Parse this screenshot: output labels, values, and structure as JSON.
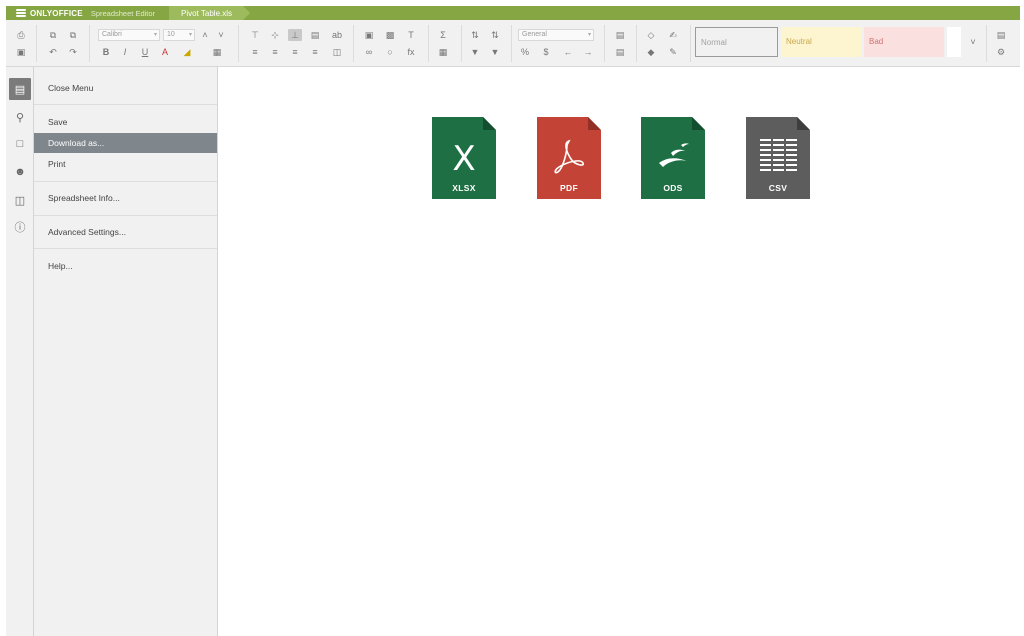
{
  "titlebar": {
    "brand": "ONLYOFFICE",
    "product": "Spreadsheet Editor",
    "document": "Pivot Table.xls",
    "color": "#86a643"
  },
  "toolbar": {
    "font_name": "Calibri",
    "font_size": "10",
    "number_format": "General",
    "styles": [
      {
        "label": "Normal",
        "color": "#a0a0a0",
        "bg": "#ffffff"
      },
      {
        "label": "Neutral",
        "color": "#c9a94d",
        "bg": "#fdf4d0"
      },
      {
        "label": "Bad",
        "color": "#d07070",
        "bg": "#fbe0e0"
      }
    ]
  },
  "leftnav": {
    "icons": [
      "file-icon",
      "search-icon",
      "comments-icon",
      "user-icon",
      "plugins-icon",
      "info-icon"
    ]
  },
  "filemenu": {
    "items": [
      {
        "label": "Close Menu"
      },
      {
        "label": "Save"
      },
      {
        "label": "Download as..."
      },
      {
        "label": "Print"
      },
      {
        "label": "Spreadsheet Info..."
      },
      {
        "label": "Advanced Settings..."
      },
      {
        "label": "Help..."
      }
    ],
    "active_item": "Download as..."
  },
  "download": {
    "formats": [
      {
        "label": "XLSX",
        "color": "#1e7044"
      },
      {
        "label": "PDF",
        "color": "#c34436"
      },
      {
        "label": "ODS",
        "color": "#1e7044"
      },
      {
        "label": "CSV",
        "color": "#5d5d5d"
      }
    ]
  }
}
